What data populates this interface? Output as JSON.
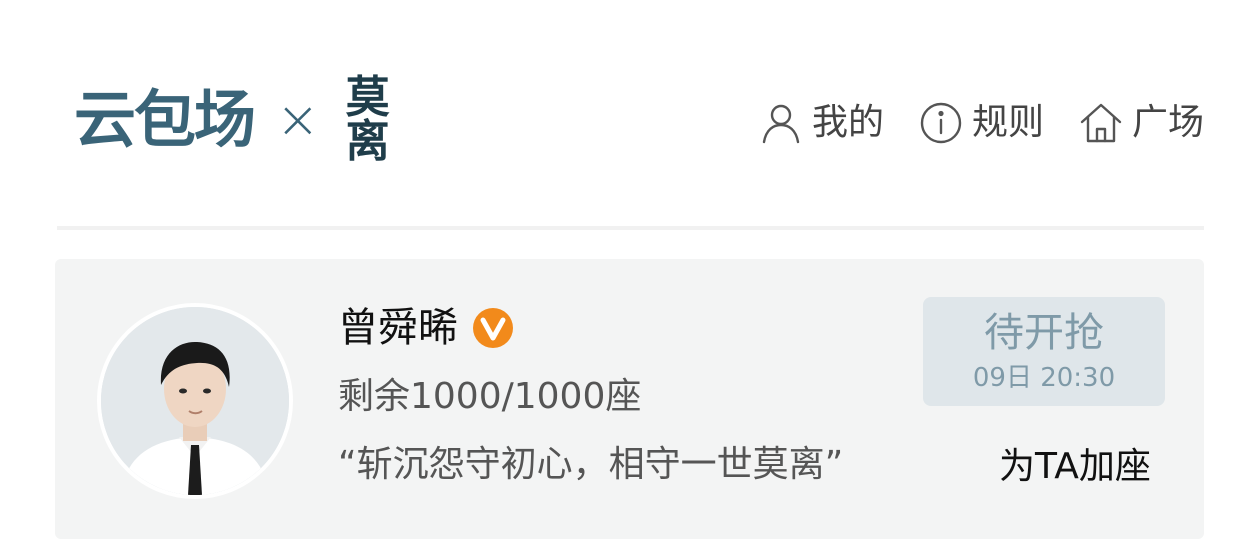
{
  "header": {
    "brand_name": "云包场",
    "separator": "×",
    "partner_chars": [
      "莫",
      "离"
    ]
  },
  "nav": [
    {
      "icon": "user-icon",
      "label": "我的"
    },
    {
      "icon": "info-icon",
      "label": "规则"
    },
    {
      "icon": "home-icon",
      "label": "广场"
    }
  ],
  "card": {
    "name": "曾舜晞",
    "remaining": "剩余1000/1000座",
    "quote": "“斩沉怨守初心，相守一世莫离”",
    "status": {
      "title": "待开抢",
      "time": "09日 20:30"
    },
    "add_seat": "为TA加座"
  },
  "colors": {
    "brand": "#3a6478",
    "status_bg": "#dfe6ea",
    "status_text": "#7f9aa8",
    "card_bg": "#f3f4f4",
    "badge": "#f28a1b"
  }
}
